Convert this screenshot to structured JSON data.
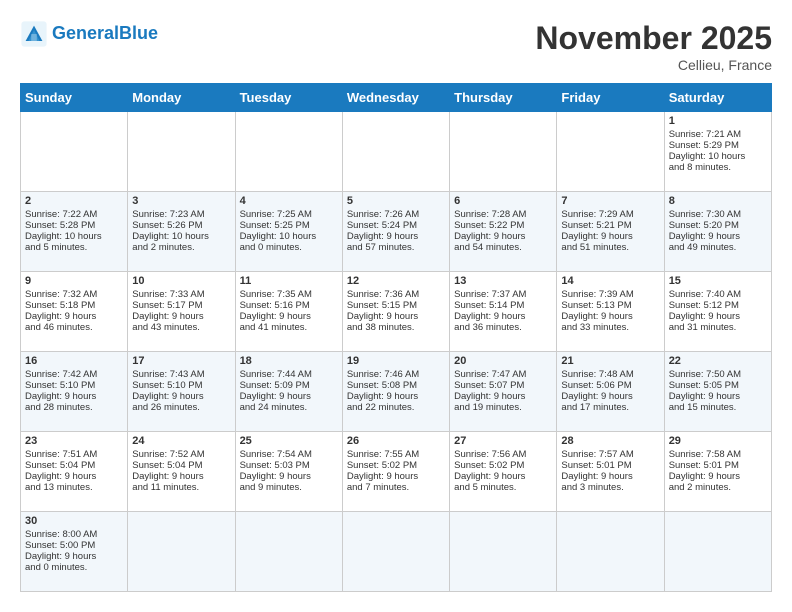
{
  "header": {
    "logo_general": "General",
    "logo_blue": "Blue",
    "month": "November 2025",
    "location": "Cellieu, France"
  },
  "days_of_week": [
    "Sunday",
    "Monday",
    "Tuesday",
    "Wednesday",
    "Thursday",
    "Friday",
    "Saturday"
  ],
  "weeks": [
    [
      {
        "day": "",
        "content": ""
      },
      {
        "day": "",
        "content": ""
      },
      {
        "day": "",
        "content": ""
      },
      {
        "day": "",
        "content": ""
      },
      {
        "day": "",
        "content": ""
      },
      {
        "day": "",
        "content": ""
      },
      {
        "day": "1",
        "content": "Sunrise: 7:21 AM\nSunset: 5:29 PM\nDaylight: 10 hours\nand 8 minutes."
      }
    ],
    [
      {
        "day": "2",
        "content": "Sunrise: 7:22 AM\nSunset: 5:28 PM\nDaylight: 10 hours\nand 5 minutes."
      },
      {
        "day": "3",
        "content": "Sunrise: 7:23 AM\nSunset: 5:26 PM\nDaylight: 10 hours\nand 2 minutes."
      },
      {
        "day": "4",
        "content": "Sunrise: 7:25 AM\nSunset: 5:25 PM\nDaylight: 10 hours\nand 0 minutes."
      },
      {
        "day": "5",
        "content": "Sunrise: 7:26 AM\nSunset: 5:24 PM\nDaylight: 9 hours\nand 57 minutes."
      },
      {
        "day": "6",
        "content": "Sunrise: 7:28 AM\nSunset: 5:22 PM\nDaylight: 9 hours\nand 54 minutes."
      },
      {
        "day": "7",
        "content": "Sunrise: 7:29 AM\nSunset: 5:21 PM\nDaylight: 9 hours\nand 51 minutes."
      },
      {
        "day": "8",
        "content": "Sunrise: 7:30 AM\nSunset: 5:20 PM\nDaylight: 9 hours\nand 49 minutes."
      }
    ],
    [
      {
        "day": "9",
        "content": "Sunrise: 7:32 AM\nSunset: 5:18 PM\nDaylight: 9 hours\nand 46 minutes."
      },
      {
        "day": "10",
        "content": "Sunrise: 7:33 AM\nSunset: 5:17 PM\nDaylight: 9 hours\nand 43 minutes."
      },
      {
        "day": "11",
        "content": "Sunrise: 7:35 AM\nSunset: 5:16 PM\nDaylight: 9 hours\nand 41 minutes."
      },
      {
        "day": "12",
        "content": "Sunrise: 7:36 AM\nSunset: 5:15 PM\nDaylight: 9 hours\nand 38 minutes."
      },
      {
        "day": "13",
        "content": "Sunrise: 7:37 AM\nSunset: 5:14 PM\nDaylight: 9 hours\nand 36 minutes."
      },
      {
        "day": "14",
        "content": "Sunrise: 7:39 AM\nSunset: 5:13 PM\nDaylight: 9 hours\nand 33 minutes."
      },
      {
        "day": "15",
        "content": "Sunrise: 7:40 AM\nSunset: 5:12 PM\nDaylight: 9 hours\nand 31 minutes."
      }
    ],
    [
      {
        "day": "16",
        "content": "Sunrise: 7:42 AM\nSunset: 5:10 PM\nDaylight: 9 hours\nand 28 minutes."
      },
      {
        "day": "17",
        "content": "Sunrise: 7:43 AM\nSunset: 5:10 PM\nDaylight: 9 hours\nand 26 minutes."
      },
      {
        "day": "18",
        "content": "Sunrise: 7:44 AM\nSunset: 5:09 PM\nDaylight: 9 hours\nand 24 minutes."
      },
      {
        "day": "19",
        "content": "Sunrise: 7:46 AM\nSunset: 5:08 PM\nDaylight: 9 hours\nand 22 minutes."
      },
      {
        "day": "20",
        "content": "Sunrise: 7:47 AM\nSunset: 5:07 PM\nDaylight: 9 hours\nand 19 minutes."
      },
      {
        "day": "21",
        "content": "Sunrise: 7:48 AM\nSunset: 5:06 PM\nDaylight: 9 hours\nand 17 minutes."
      },
      {
        "day": "22",
        "content": "Sunrise: 7:50 AM\nSunset: 5:05 PM\nDaylight: 9 hours\nand 15 minutes."
      }
    ],
    [
      {
        "day": "23",
        "content": "Sunrise: 7:51 AM\nSunset: 5:04 PM\nDaylight: 9 hours\nand 13 minutes."
      },
      {
        "day": "24",
        "content": "Sunrise: 7:52 AM\nSunset: 5:04 PM\nDaylight: 9 hours\nand 11 minutes."
      },
      {
        "day": "25",
        "content": "Sunrise: 7:54 AM\nSunset: 5:03 PM\nDaylight: 9 hours\nand 9 minutes."
      },
      {
        "day": "26",
        "content": "Sunrise: 7:55 AM\nSunset: 5:02 PM\nDaylight: 9 hours\nand 7 minutes."
      },
      {
        "day": "27",
        "content": "Sunrise: 7:56 AM\nSunset: 5:02 PM\nDaylight: 9 hours\nand 5 minutes."
      },
      {
        "day": "28",
        "content": "Sunrise: 7:57 AM\nSunset: 5:01 PM\nDaylight: 9 hours\nand 3 minutes."
      },
      {
        "day": "29",
        "content": "Sunrise: 7:58 AM\nSunset: 5:01 PM\nDaylight: 9 hours\nand 2 minutes."
      }
    ],
    [
      {
        "day": "30",
        "content": "Sunrise: 8:00 AM\nSunset: 5:00 PM\nDaylight: 9 hours\nand 0 minutes."
      },
      {
        "day": "",
        "content": ""
      },
      {
        "day": "",
        "content": ""
      },
      {
        "day": "",
        "content": ""
      },
      {
        "day": "",
        "content": ""
      },
      {
        "day": "",
        "content": ""
      },
      {
        "day": "",
        "content": ""
      }
    ]
  ]
}
